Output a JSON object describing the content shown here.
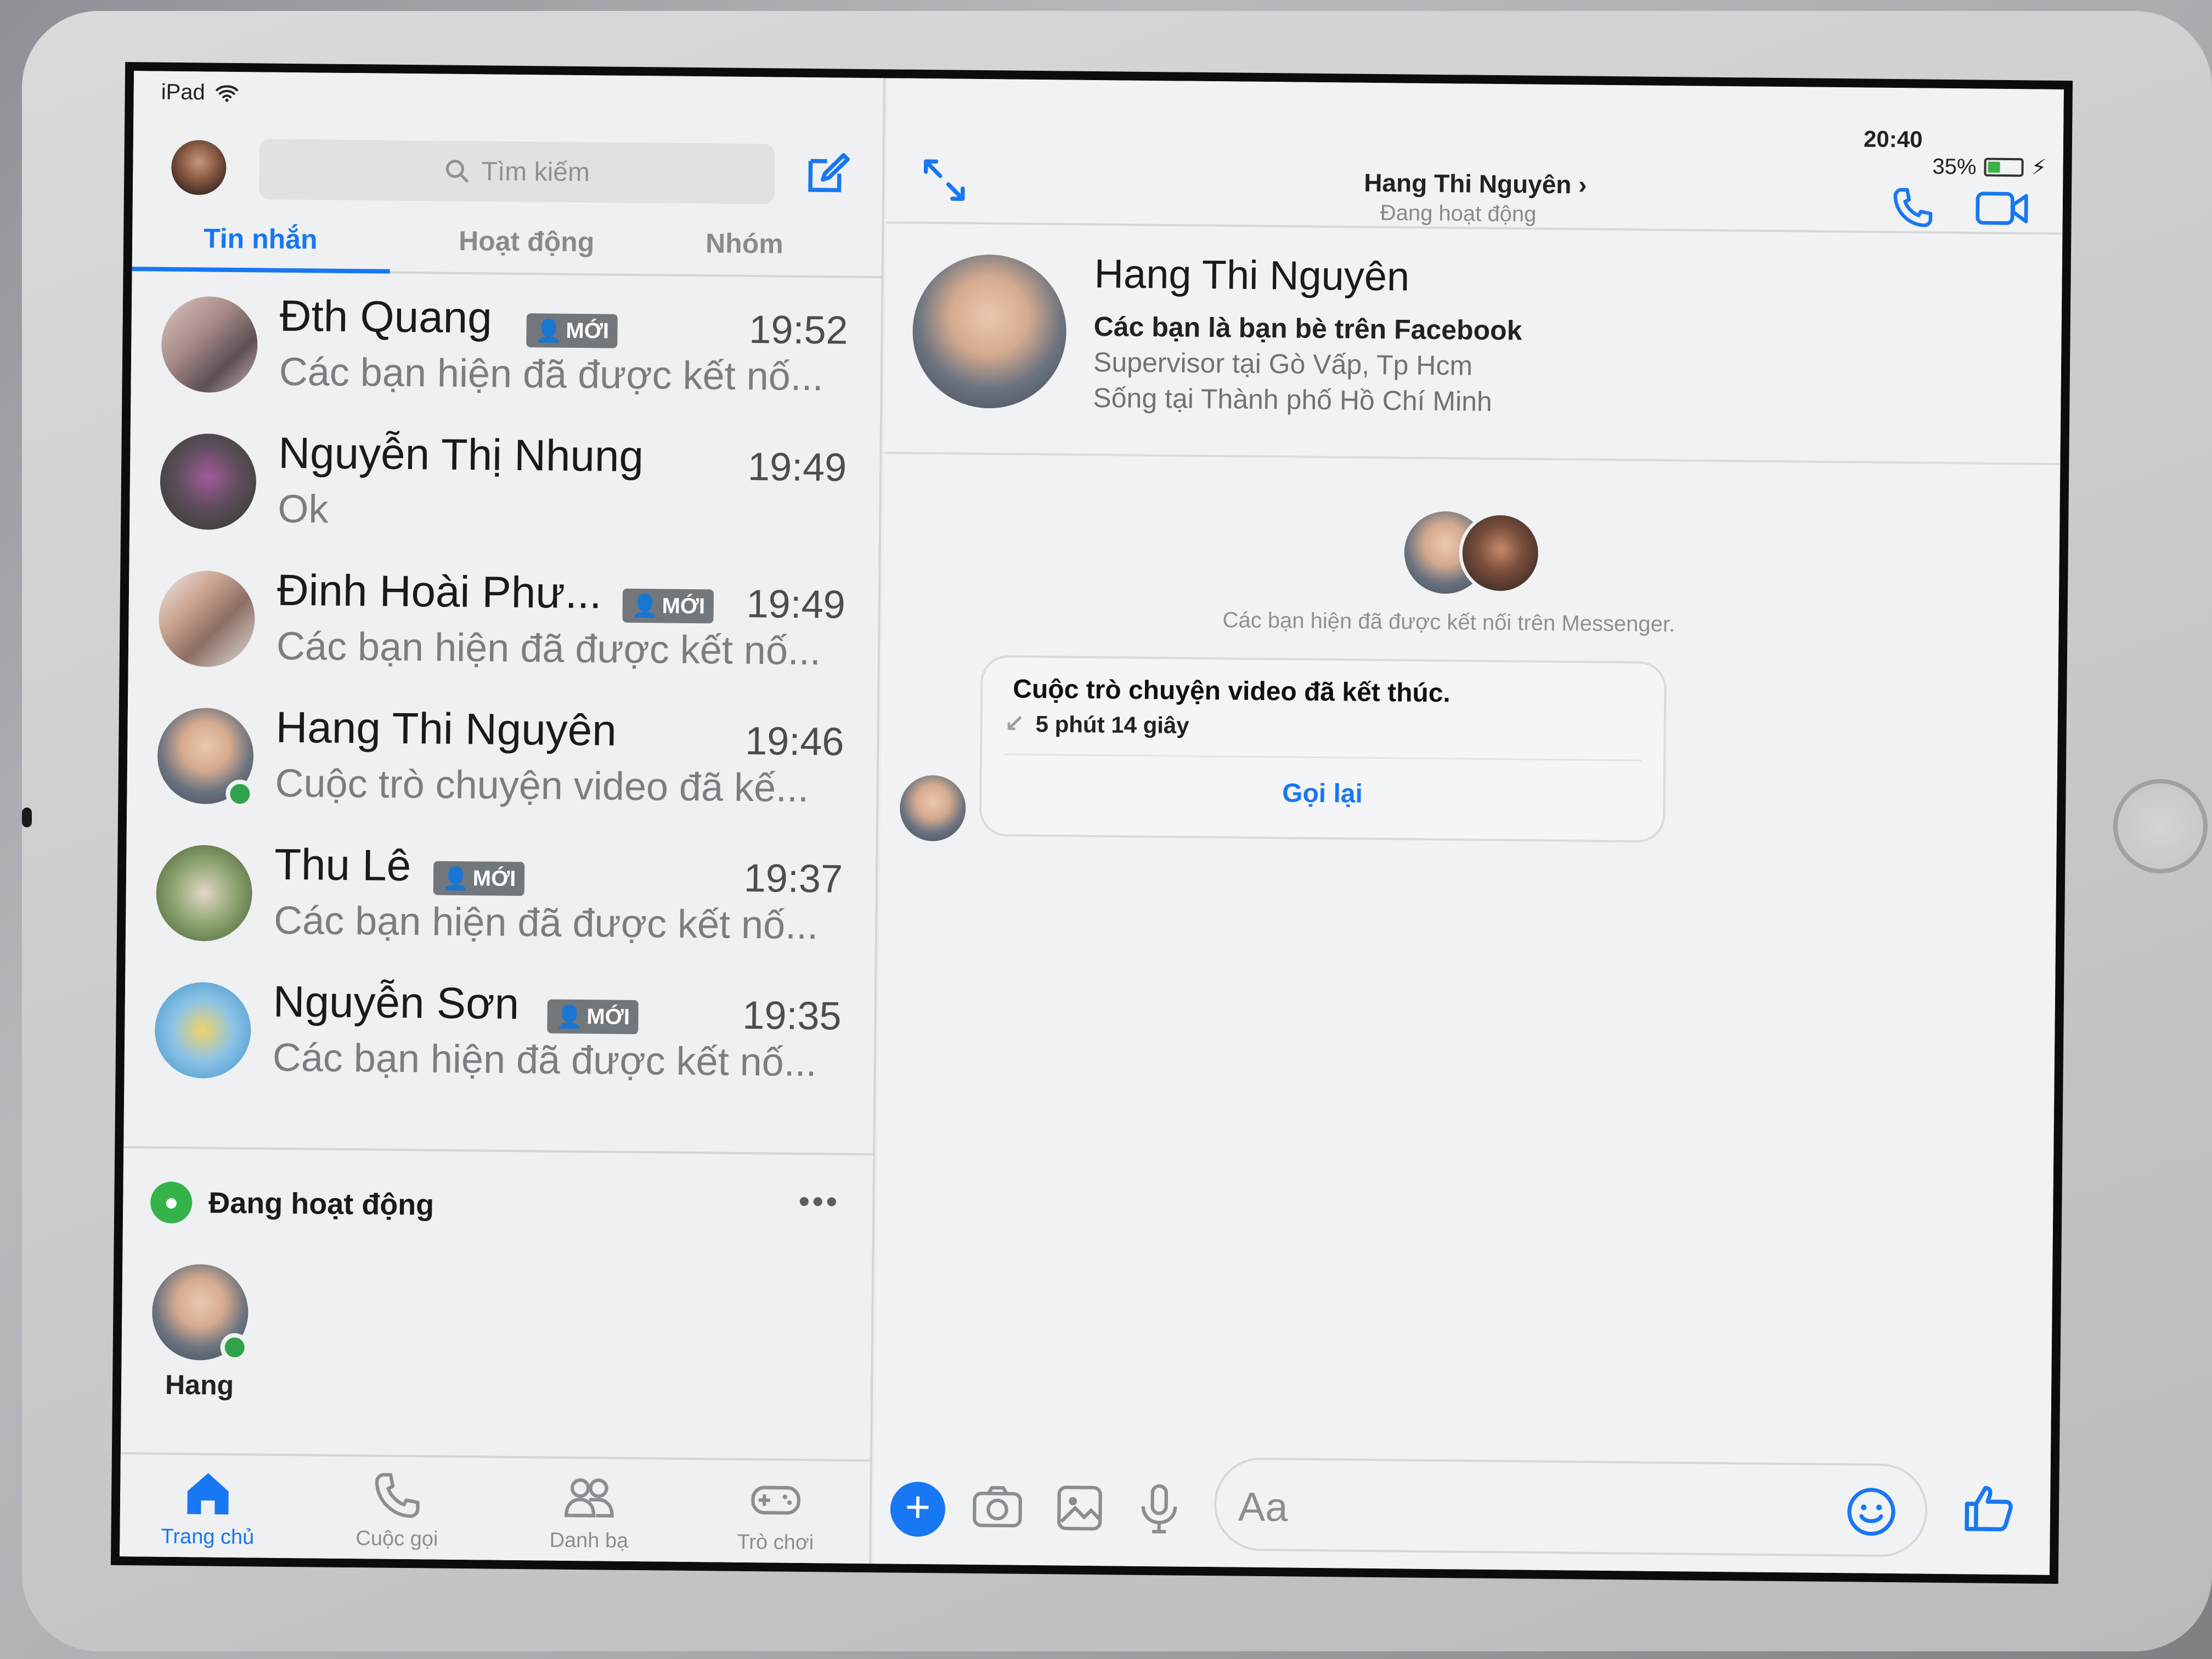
{
  "status_bar": {
    "device": "iPad",
    "time": "20:40",
    "battery": "35%"
  },
  "left": {
    "search_placeholder": "Tìm kiếm",
    "tabs": [
      {
        "label": "Tin nhắn"
      },
      {
        "label": "Hoạt động"
      },
      {
        "label": "Nhóm"
      }
    ],
    "conversations": [
      {
        "name": "Đth Quang",
        "badge": "MỚI",
        "time": "19:52",
        "preview": "Các bạn hiện đã được kết nố..."
      },
      {
        "name": "Nguyễn Thị Nhung",
        "badge": "",
        "time": "19:49",
        "preview": "Ok"
      },
      {
        "name": "Đinh Hoài Phư...",
        "badge": "MỚI",
        "time": "19:49",
        "preview": "Các bạn hiện đã được kết nố..."
      },
      {
        "name": "Hang Thi Nguyên",
        "badge": "",
        "time": "19:46",
        "preview": "Cuộc trò chuyện video đã kế..."
      },
      {
        "name": "Thu Lê",
        "badge": "MỚI",
        "time": "19:37",
        "preview": "Các bạn hiện đã được kết nố..."
      },
      {
        "name": "Nguyễn Sơn",
        "badge": "MỚI",
        "time": "19:35",
        "preview": "Các bạn hiện đã được kết nố..."
      }
    ],
    "active_header": "Đang hoạt động",
    "active_more": "•••",
    "active_user": "Hang",
    "nav": [
      {
        "label": "Trang chủ"
      },
      {
        "label": "Cuộc gọi"
      },
      {
        "label": "Danh bạ"
      },
      {
        "label": "Trò chơi"
      }
    ]
  },
  "chat": {
    "header_name": "Hang Thi Nguyên ›",
    "header_status": "Đang hoạt động",
    "profile": {
      "name": "Hang Thi Nguyên",
      "friend_line": "Các bạn là bạn bè trên Facebook",
      "work": "Supervisor tại Gò Vấp, Tp Hcm",
      "lives": "Sống tại Thành phố Hồ Chí Minh"
    },
    "connected_text": "Các bạn hiện đã được kết nối trên Messenger.",
    "call_card": {
      "title": "Cuộc trò chuyện video đã kết thúc.",
      "duration": "5 phút 14 giây",
      "callback": "Gọi lại"
    },
    "composer_placeholder": "Aa"
  },
  "colors": {
    "accent": "#1877f2",
    "online": "#31a24c"
  }
}
